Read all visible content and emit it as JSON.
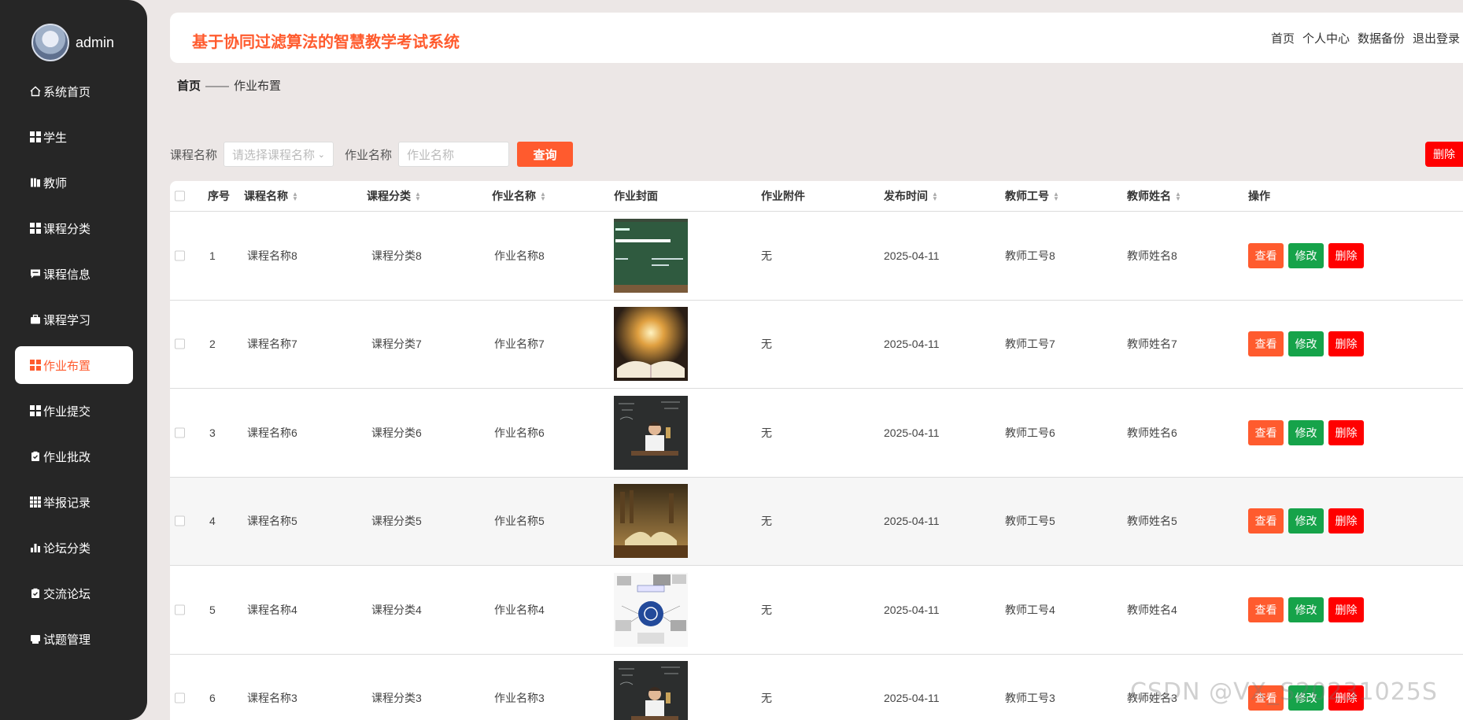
{
  "user": {
    "name": "admin"
  },
  "menu": [
    {
      "label": "系统首页",
      "icon": "home-icon"
    },
    {
      "label": "学生",
      "icon": "grid-icon"
    },
    {
      "label": "教师",
      "icon": "book-icon"
    },
    {
      "label": "课程分类",
      "icon": "grid-icon"
    },
    {
      "label": "课程信息",
      "icon": "chat-icon"
    },
    {
      "label": "课程学习",
      "icon": "briefcase-icon"
    },
    {
      "label": "作业布置",
      "icon": "grid-icon",
      "active": true
    },
    {
      "label": "作业提交",
      "icon": "grid-icon"
    },
    {
      "label": "作业批改",
      "icon": "clipboard-icon"
    },
    {
      "label": "举报记录",
      "icon": "grid9-icon"
    },
    {
      "label": "论坛分类",
      "icon": "bar-chart-icon"
    },
    {
      "label": "交流论坛",
      "icon": "clipboard-icon"
    },
    {
      "label": "试题管理",
      "icon": "printer-icon"
    }
  ],
  "header": {
    "title": "基于协同过滤算法的智慧教学考试系统",
    "links": [
      "首页",
      "个人中心",
      "数据备份",
      "退出登录"
    ]
  },
  "breadcrumb": {
    "home": "首页",
    "sep": "——",
    "current": "作业布置"
  },
  "search": {
    "course_label": "课程名称",
    "course_placeholder": "请选择课程名称",
    "homework_label": "作业名称",
    "homework_placeholder": "作业名称",
    "query_button": "查询",
    "delete_button": "删除"
  },
  "table": {
    "headers": [
      "序号",
      "课程名称",
      "课程分类",
      "作业名称",
      "作业封面",
      "作业附件",
      "发布时间",
      "教师工号",
      "教师姓名",
      "操作"
    ],
    "actions": {
      "view": "查看",
      "edit": "修改",
      "delete": "删除"
    },
    "rows": [
      {
        "no": "1",
        "course": "课程名称8",
        "category": "课程分类8",
        "homework": "作业名称8",
        "attachment": "无",
        "date": "2025-04-11",
        "teacher_id": "教师工号8",
        "teacher_name": "教师姓名8",
        "cover": "blackboard"
      },
      {
        "no": "2",
        "course": "课程名称7",
        "category": "课程分类7",
        "homework": "作业名称7",
        "attachment": "无",
        "date": "2025-04-11",
        "teacher_id": "教师工号7",
        "teacher_name": "教师姓名7",
        "cover": "glowing-book"
      },
      {
        "no": "3",
        "course": "课程名称6",
        "category": "课程分类6",
        "homework": "作业名称6",
        "attachment": "无",
        "date": "2025-04-11",
        "teacher_id": "教师工号6",
        "teacher_name": "教师姓名6",
        "cover": "boy-chalkboard"
      },
      {
        "no": "4",
        "course": "课程名称5",
        "category": "课程分类5",
        "homework": "作业名称5",
        "attachment": "无",
        "date": "2025-04-11",
        "teacher_id": "教师工号5",
        "teacher_name": "教师姓名5",
        "cover": "open-book-library"
      },
      {
        "no": "5",
        "course": "课程名称4",
        "category": "课程分类4",
        "homework": "作业名称4",
        "attachment": "无",
        "date": "2025-04-11",
        "teacher_id": "教师工号4",
        "teacher_name": "教师姓名4",
        "cover": "mind-map"
      },
      {
        "no": "6",
        "course": "课程名称3",
        "category": "课程分类3",
        "homework": "作业名称3",
        "attachment": "无",
        "date": "2025-04-11",
        "teacher_id": "教师工号3",
        "teacher_name": "教师姓名3",
        "cover": "boy-chalkboard"
      }
    ]
  },
  "watermark": "CSDN @VX_S20231025S",
  "colors": {
    "accent": "#ff5b2e",
    "edit": "#16a34a",
    "danger": "#ff0000",
    "sidebar": "#262626"
  }
}
